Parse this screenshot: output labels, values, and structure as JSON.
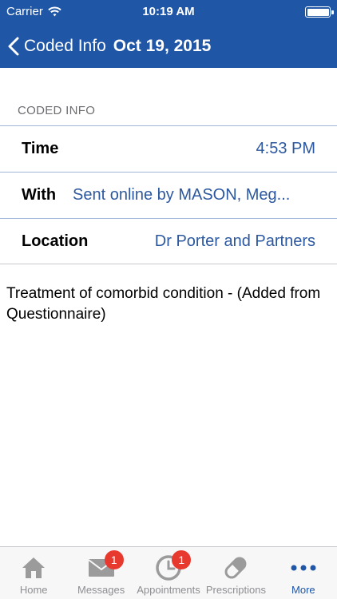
{
  "status_bar": {
    "carrier": "Carrier",
    "time": "10:19 AM"
  },
  "nav": {
    "back_label": "Coded Info",
    "title": "Oct 19, 2015"
  },
  "section": {
    "header": "CODED INFO"
  },
  "rows": [
    {
      "label": "Time",
      "value": "4:53 PM"
    },
    {
      "label": "With",
      "value": "Sent online by MASON, Meg..."
    },
    {
      "label": "Location",
      "value": "Dr Porter and Partners"
    }
  ],
  "note": "Treatment of comorbid condition - (Added from Questionnaire)",
  "tabs": [
    {
      "label": "Home",
      "icon": "home-icon"
    },
    {
      "label": "Messages",
      "icon": "envelope-icon",
      "badge": "1"
    },
    {
      "label": "Appointments",
      "icon": "clock-icon",
      "badge": "1"
    },
    {
      "label": "Prescriptions",
      "icon": "pill-icon"
    },
    {
      "label": "More",
      "icon": "more-icon",
      "active": true
    }
  ],
  "colors": {
    "header": "#2056a6",
    "link": "#2c58a0",
    "badge": "#e8392f",
    "tab_inactive": "#8e8e93",
    "tab_active": "#2056a6"
  }
}
